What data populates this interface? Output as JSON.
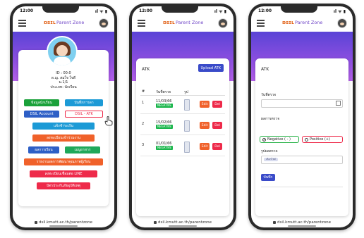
{
  "common": {
    "status_time": "12:00",
    "status_icons": "ıl ᯤ ▮",
    "logo": "ɒsɪʟ",
    "app_title": "Parent Zone",
    "footer_url": "dsil.kmutt.ac.th/parentzone"
  },
  "profile": {
    "id_line": "ID : 00:0",
    "name_line": "ด.ญ. สมใจ ใจดี",
    "class_line": "ม.1/1",
    "status_line": "ประเภท: นักเรียน"
  },
  "menu": {
    "student_info": "ข้อมูลนักเรียน",
    "leave_record": "บันทึกการลา",
    "dsil_account": "DSIL Account",
    "dsil_atk": "DSIL - ATK",
    "notify_payment": "แจ้งชำระเงิน",
    "register_activity": "ลงทะเบียนเข้าร่วมงาน",
    "transcript": "ผลการเรียน",
    "canteen": "เมนูอาหาร",
    "report_development": "รายงานผลการพัฒนาคุณภาพผู้เรียน",
    "register_line": "ลงทะเบียนเชื่อมต่อ LINE",
    "accident_insurance": "บัตรประกันภัยอุบัติเหตุ"
  },
  "atk": {
    "title": "ATK",
    "upload_button": "Upload ATK",
    "col_no": "#",
    "col_date": "วันที่ตรวจ",
    "col_image": "รูป",
    "edit_label": "Edit",
    "delete_label": "Del",
    "rows": [
      {
        "no": "1",
        "date": "11/03/66",
        "result": "NEGATIVE"
      },
      {
        "no": "2",
        "date": "15/02/66",
        "result": "NEGATIVE"
      },
      {
        "no": "3",
        "date": "01/01/66",
        "result": "NEGATIVE"
      }
    ]
  },
  "atk_form": {
    "title": "ATK",
    "date_label": "วันที่ตรวจ",
    "date_value": "",
    "result_label": "ผลการตรวจ",
    "negative_label": "Negative ( - )",
    "positive_label": "Positive (+)",
    "selected": "negative",
    "image_label": "รูปผลตรวจ",
    "file_chip": "เลือกไฟล์",
    "save_button": "บันทึก"
  },
  "colors": {
    "gradient_top": "#5a43d6",
    "gradient_bottom": "#b35fe8",
    "accent_purple": "#6f45c7",
    "green": "#1aa13a",
    "blue": "#1c9ad6",
    "orange": "#f0612a",
    "red": "#ee2a4a"
  }
}
